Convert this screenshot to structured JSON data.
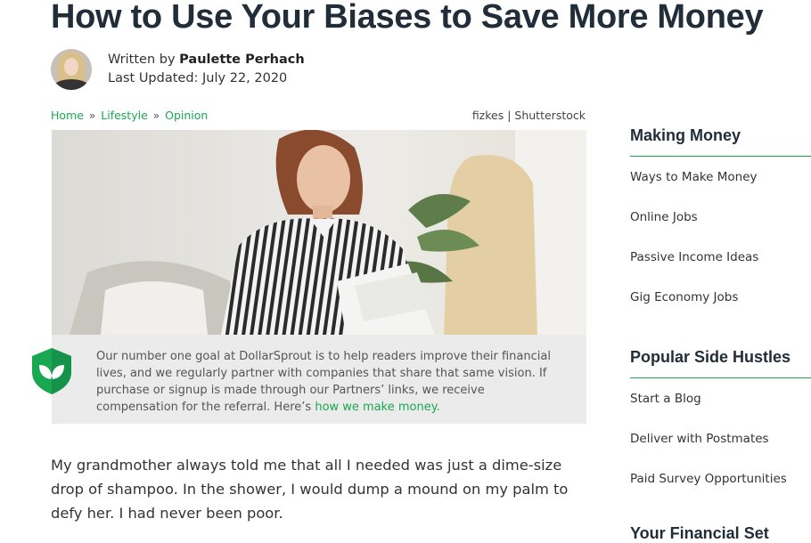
{
  "article": {
    "title": "How to Use Your Biases to Save More Money",
    "written_by_prefix": "Written by",
    "author": "Paulette Perhach",
    "updated_label": "Last Updated:",
    "updated_date": "July 22, 2020"
  },
  "breadcrumb": {
    "items": [
      "Home",
      "Lifestyle",
      "Opinion"
    ],
    "separator": "»"
  },
  "image_credit": "fizkes | Shutterstock",
  "disclosure": {
    "text": "Our number one goal at DollarSprout is to help readers improve their financial lives, and we regularly partner with companies that share that same vision. If purchase or signup is made through our Partners’ links, we receive compensation for the referral. Here’s",
    "link_text": "how we make money."
  },
  "body": {
    "paragraph1": "My grandmother always told me that all I needed was just a dime-size drop of shampoo. In the shower, I would dump a mound on my palm to defy her. I had never been poor."
  },
  "sidebar": {
    "section1": {
      "heading": "Making Money",
      "items": [
        "Ways to Make Money",
        "Online Jobs",
        "Passive Income Ideas",
        "Gig Economy Jobs"
      ]
    },
    "section2": {
      "heading": "Popular Side Hustles",
      "items": [
        "Start a Blog",
        "Deliver with Postmates",
        "Paid Survey Opportunities"
      ]
    },
    "section3": {
      "heading": "Your Financial Set"
    }
  },
  "colors": {
    "accent": "#1aa752",
    "heading": "#222d3a",
    "disclosure_bg": "#ebebeb"
  }
}
